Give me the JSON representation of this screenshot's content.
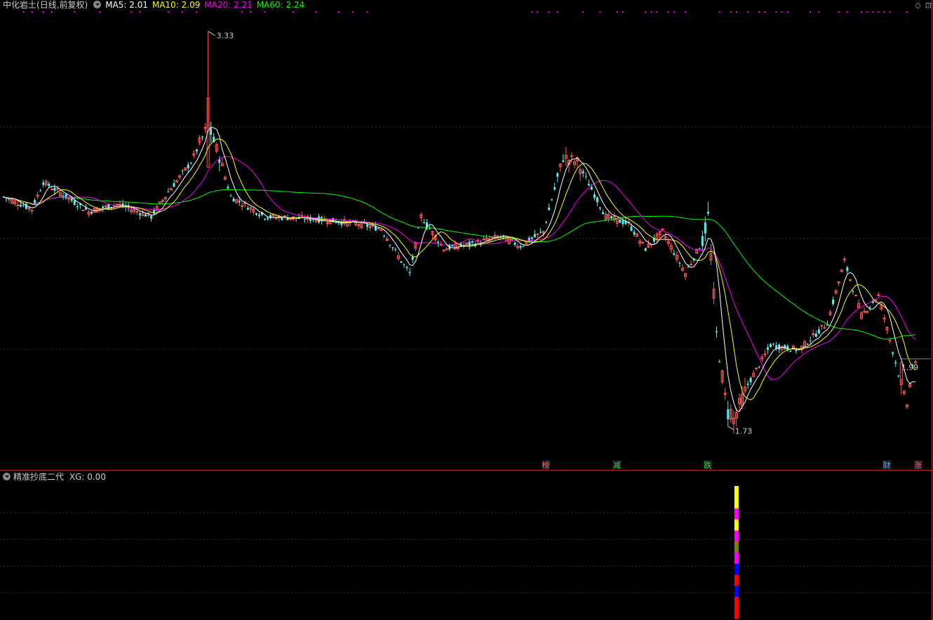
{
  "header": {
    "stock_name": "中化岩土",
    "period": "(日线,前复权)",
    "ma": [
      {
        "label": "MA5:",
        "value": "2.01",
        "color": "#ffffff"
      },
      {
        "label": "MA10:",
        "value": "2.09",
        "color": "#ffff00"
      },
      {
        "label": "MA20:",
        "value": "2.21",
        "color": "#ff00ff"
      },
      {
        "label": "MA60:",
        "value": "2.24",
        "color": "#00ff00"
      }
    ]
  },
  "indicator": {
    "name": "精准抄底二代",
    "label": "XG:",
    "value": "0.00"
  },
  "top_right": {
    "diamond_icon": "diamond-icon",
    "expand_icon": "expand-icon"
  },
  "chart_data": {
    "type": "candlestick",
    "title": "",
    "price_range": [
      1.64,
      3.4
    ],
    "annotations": [
      {
        "text": "3.33",
        "kind": "high",
        "day": 72
      },
      {
        "text": "1.73",
        "kind": "low",
        "day": 255
      },
      {
        "text": "1.99",
        "kind": "last",
        "day": 316
      }
    ],
    "event_tags": [
      {
        "text": "榜",
        "day": 191,
        "color": "#ff6a6a"
      },
      {
        "text": "减",
        "day": 216,
        "color": "#3fd33f"
      },
      {
        "text": "跌",
        "day": 248,
        "color": "#3fd33f"
      },
      {
        "text": "财",
        "day": 311,
        "color": "#6fa8ff"
      },
      {
        "text": "涨",
        "day": 322,
        "color": "#ff6a6a"
      }
    ],
    "colors": {
      "up": "#ff5a5a",
      "down": "#55f0f0",
      "ma5": "#ffffff",
      "ma10": "#ffff00",
      "ma20": "#ff00ff",
      "ma60": "#00ff00"
    },
    "indicator_signal": {
      "day": 258,
      "value": 1
    },
    "signal_colors": [
      "#ff0000",
      "#ff0000",
      "#0000ff",
      "#ff0000",
      "#0000ff",
      "#ff00ff",
      "#808000",
      "#ff00ff",
      "#ffff00",
      "#ff00ff",
      "#ffff00",
      "#ffff00"
    ]
  }
}
